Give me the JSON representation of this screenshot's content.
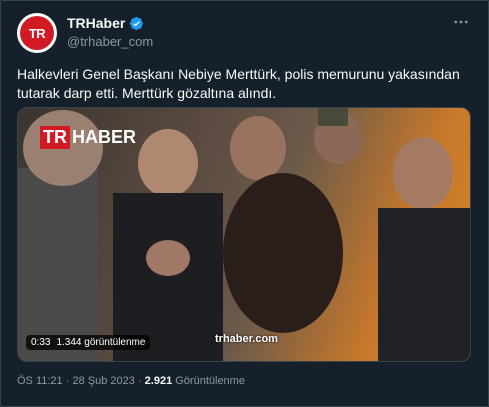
{
  "author": {
    "avatar_text": "TR",
    "name": "TRHaber",
    "handle": "@trhaber_com"
  },
  "more_icon": "more-horizontal-icon",
  "tweet": {
    "text": "Halkevleri Genel Başkanı Nebiye Merttürk, polis memurunu yakasından tutarak darp etti. Merttürk gözaltına alındı."
  },
  "media": {
    "logo_tr": "TR",
    "logo_haber": "HABER",
    "duration": "0:33",
    "views": "1.344 görüntülenme",
    "watermark": "trhaber.com"
  },
  "meta": {
    "time": "ÖS 11:21",
    "separator": "·",
    "date": "28 Şub 2023",
    "view_count": "2.921",
    "views_label": "Görüntülenme"
  },
  "colors": {
    "background": "#15202b",
    "border": "#38444d",
    "secondary_text": "#8b98a5",
    "verified": "#1d9bf0",
    "brand_red": "#d11a24"
  }
}
